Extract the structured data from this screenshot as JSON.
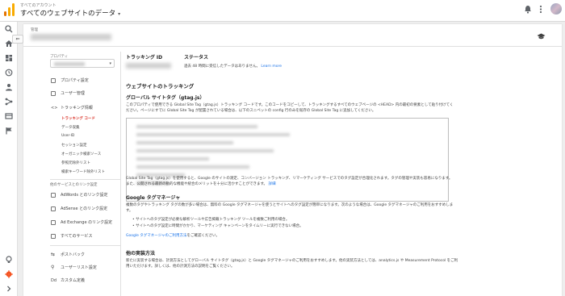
{
  "header": {
    "account_label": "すべてのアカウント",
    "view_name": "すべてのウェブサイトのデータ",
    "caret": "▾",
    "bell_icon": "bell-icon",
    "more_icon": "more-vert-icon"
  },
  "rail": {
    "icons": [
      "search-icon",
      "home-icon",
      "dashboard-icon",
      "clock-icon",
      "person-icon",
      "acquisition-icon",
      "behavior-icon",
      "flag-icon",
      "lightbulb-icon",
      "gear-icon",
      "expand-icon"
    ]
  },
  "panel": {
    "head_label": "管理",
    "property_label": "プロパティ",
    "back_arrow": "⇐"
  },
  "sidebar": {
    "items": [
      {
        "label": "プロパティ設定"
      },
      {
        "label": "ユーザー管理"
      },
      {
        "label": "トラッキング情報"
      }
    ],
    "sub_items": [
      {
        "label": "トラッキング コード",
        "active": true
      },
      {
        "label": "データ収集"
      },
      {
        "label": "User-ID"
      },
      {
        "label": "セッション設定"
      },
      {
        "label": "オーガニック検索ソース"
      },
      {
        "label": "参照元除外リスト"
      },
      {
        "label": "検索キーワード除外リスト"
      }
    ],
    "section_head": "他のサービスとのリンク設定",
    "product_links": [
      {
        "label": "AdWords とのリンク設定"
      },
      {
        "label": "AdSense とのリンク設定"
      },
      {
        "label": "Ad Exchange のリンク設定"
      },
      {
        "label": "すべてのサービス"
      }
    ],
    "bottom_items": [
      {
        "label": "ポストバック"
      },
      {
        "label": "ユーザーリスト設定"
      },
      {
        "label": "カスタム定義",
        "prefix": "Dd"
      }
    ]
  },
  "main": {
    "tracking_id_heading": "トラッキング ID",
    "status_heading": "ステータス",
    "status_text": "過去 48 時間に受信したデータはありません。",
    "status_link": "Learn more",
    "website_tracking_heading": "ウェブサイトのトラッキング",
    "gtag_heading": "グローバル サイトタグ（gtag.js）",
    "gtag_desc_1": "このプロパティで使用できる Global Site Tag（gtag.js）トラッキング コードです。このコードをコピーして、トラッキングするすべてのウェブページの <HEAD> 内の最初の要素として貼り付けてく",
    "gtag_desc_2": "ださい。ページにすでに Global Site Tag が配置されている場合は、以下のスニペットの config 行のみを既存の Global Site Tag に追加してください。",
    "gtag_after_1": "Global Site Tag（gtag.js）を使用すると、Google のサイトの測定、コンバージョン トラッキング、リマーケティング サービスでのタグ設定が合理化されます。タグの管理や実装も容易になります。",
    "gtag_after_2": "また、公開される最新の動的な機能や統合のメリットを十分に活かすことができます。",
    "gtag_after_link": "詳細",
    "gtm_heading": "Google タグマネージャ",
    "gtm_desc": "複数のタグやトラッキング タグの数が多い場合は、無料の Google タグマネージャを使うとサイトへのタグ設定が簡単になります。次のような場合は、Google タグマネージャのご利用をおすすめしま",
    "gtm_desc_2": "す。",
    "gtm_bullets": [
      "サイトへのタグ設定が必要な解析ツールや広告掲載トラッキング ツールを複数ご利用の場合。",
      "サイトへのタグ設定に時間がかかり、マーケティング キャンペーンをタイムリーに実行できない場合。"
    ],
    "gtm_link": "Google タグマネージャのご利用方法",
    "gtm_link_suffix": "をご確認ください。",
    "other_heading": "他の実装方法",
    "other_desc_1": "新たに実装する場合は、計測方法としてグローバル サイトタグ（gtag.js）と Google タグマネージャのご利用をおすすめします。他の実装方法としては、analytics.js や Measurement Protocol をご利",
    "other_desc_2": "用いただけます。詳しくは、他の計測方法の説明をご覧ください。"
  }
}
